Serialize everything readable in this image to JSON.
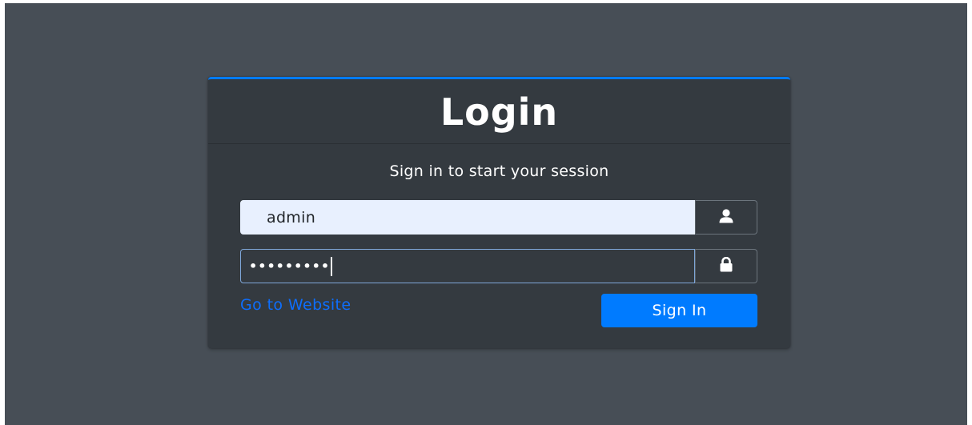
{
  "login": {
    "title": "Login",
    "subtitle": "Sign in to start your session",
    "username": {
      "value": "admin",
      "icon": "user-icon"
    },
    "password": {
      "masked_value": "•••••••••",
      "icon": "lock-icon"
    },
    "website_link": "Go to Website",
    "sign_in_label": "Sign In"
  },
  "colors": {
    "background": "#474e56",
    "card": "#343a40",
    "accent": "#007bff",
    "autofill": "#e8f0fe",
    "link": "#0d6efd"
  }
}
